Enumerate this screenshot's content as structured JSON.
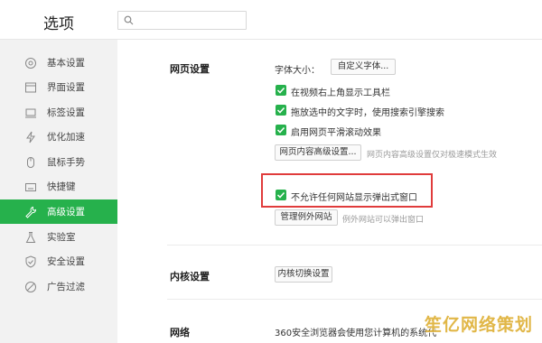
{
  "app": {
    "title": "选项"
  },
  "search": {
    "value": "",
    "placeholder": ""
  },
  "sidebar": {
    "items": [
      {
        "label": "基本设置",
        "icon": "circle-settings-icon"
      },
      {
        "label": "界面设置",
        "icon": "window-icon"
      },
      {
        "label": "标签设置",
        "icon": "tab-icon"
      },
      {
        "label": "优化加速",
        "icon": "lightning-icon"
      },
      {
        "label": "鼠标手势",
        "icon": "mouse-icon"
      },
      {
        "label": "快捷键",
        "icon": "keyboard-icon"
      },
      {
        "label": "高级设置",
        "icon": "wrench-icon",
        "active": true
      },
      {
        "label": "实验室",
        "icon": "flask-icon"
      },
      {
        "label": "安全设置",
        "icon": "shield-icon"
      },
      {
        "label": "广告过滤",
        "icon": "block-icon"
      }
    ]
  },
  "webpage": {
    "title": "网页设置",
    "font_size_label": "字体大小：",
    "custom_font_button": "自定义字体...",
    "options": [
      {
        "label": "在视频右上角显示工具栏",
        "checked": true
      },
      {
        "label": "拖放选中的文字时，使用搜索引擎搜索",
        "checked": true
      },
      {
        "label": "启用网页平滑滚动效果",
        "checked": true
      }
    ],
    "advanced_button": "网页内容高级设置...",
    "advanced_hint": "网页内容高级设置仅对极速模式生效",
    "popup_option": {
      "label": "不允许任何网站显示弹出式窗口",
      "checked": true
    },
    "exceptions_button": "管理例外网站",
    "exceptions_hint": "例外网站可以弹出窗口"
  },
  "kernel": {
    "title": "内核设置",
    "switch_button": "内核切换设置"
  },
  "network": {
    "title": "网络",
    "desc": "360安全浏览器会使用您计算机的系统代"
  },
  "watermark": "笙亿网络策划",
  "colors": {
    "accent": "#26b14c",
    "highlight": "#e03c3c"
  }
}
